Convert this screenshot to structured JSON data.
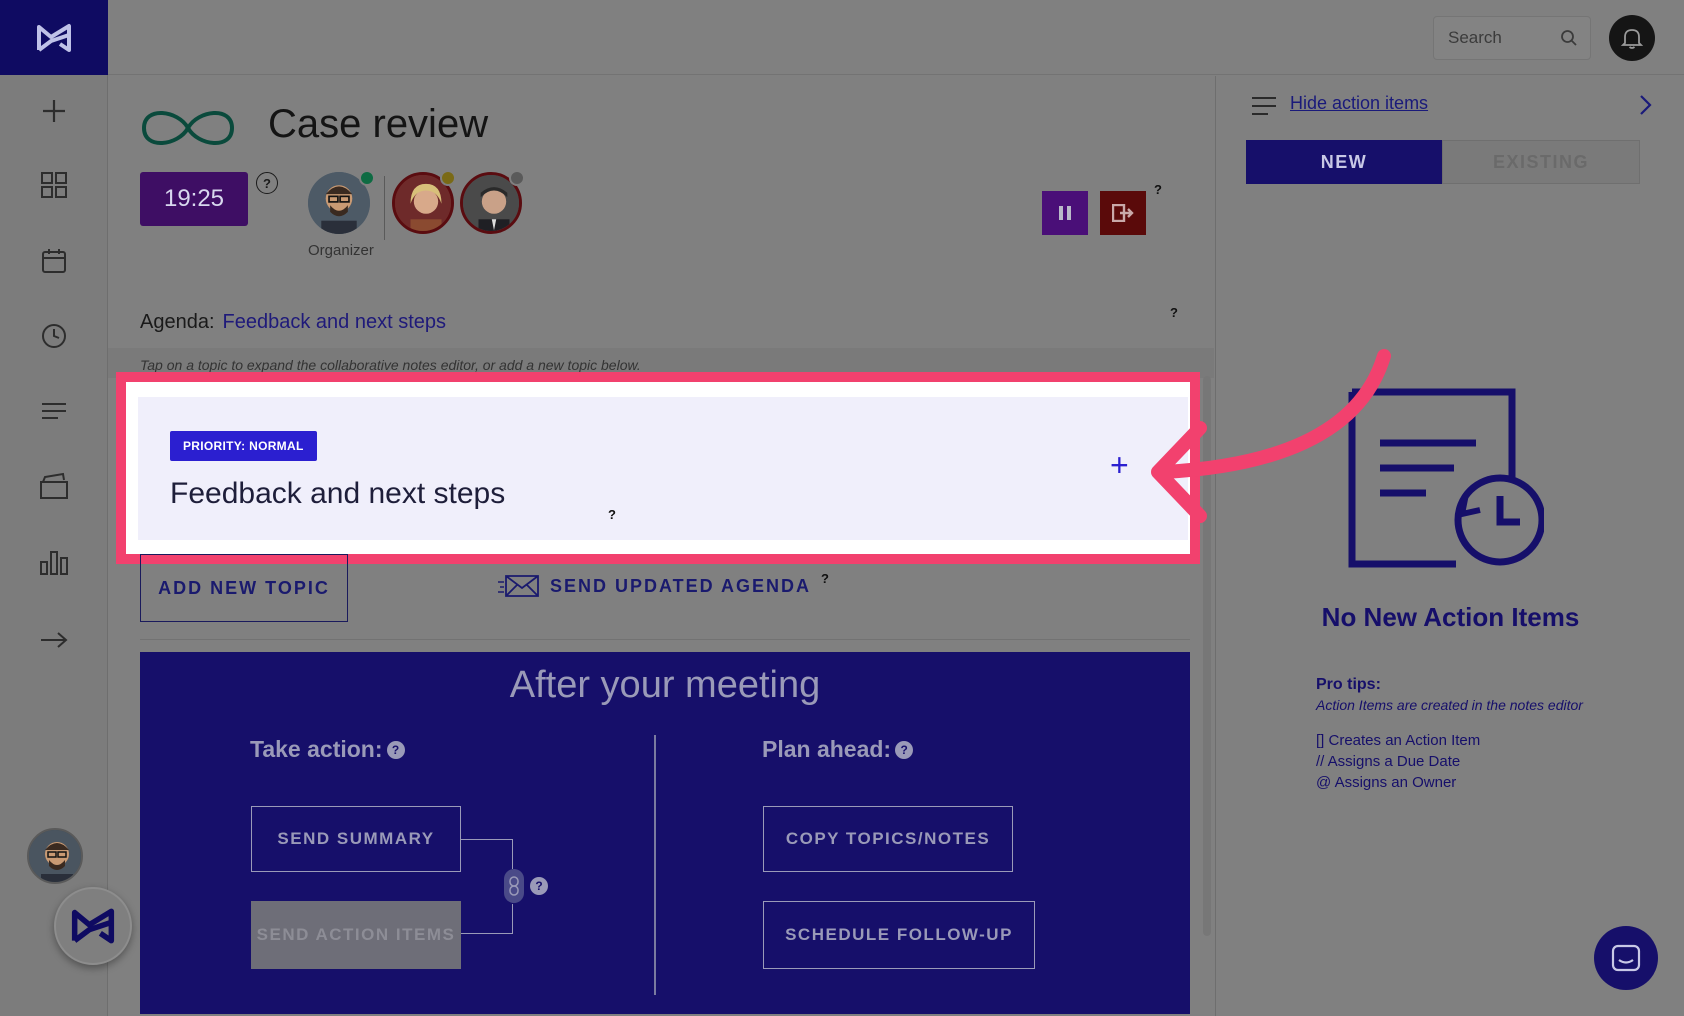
{
  "app": {
    "brand_color": "#0f0b62",
    "accent": "#2b1fd0",
    "highlight": "#f2416e"
  },
  "topbar": {
    "search_placeholder": "Search"
  },
  "meeting": {
    "title": "Case review",
    "timer": "19:25",
    "organizer_label": "Organizer",
    "agenda_label": "Agenda:",
    "agenda_value": "Feedback and next steps",
    "hint": "Tap on a topic to expand the collaborative notes editor, or add a new topic below."
  },
  "topic": {
    "priority": "PRIORITY: NORMAL",
    "title": "Feedback and next steps",
    "plus": "+"
  },
  "actions": {
    "add_topic": "ADD NEW TOPIC",
    "send_agenda": "SEND UPDATED AGENDA"
  },
  "after_meeting": {
    "title": "After your meeting",
    "take_action": "Take action:",
    "plan_ahead": "Plan ahead:",
    "send_summary": "SEND SUMMARY",
    "send_action_items": "SEND ACTION ITEMS",
    "copy_topics": "COPY TOPICS/NOTES",
    "schedule_followup": "SCHEDULE FOLLOW-UP"
  },
  "right_panel": {
    "hide_link": "Hide action items",
    "tab_new": "NEW",
    "tab_existing": "EXISTING",
    "empty_title": "No New Action Items",
    "tips_head": "Pro tips:",
    "tips_sub": "Action Items are created in the notes editor",
    "tip1": "[] Creates an Action Item",
    "tip2": "// Assigns a Due Date",
    "tip3": "@ Assigns an Owner"
  },
  "help_mark": "?"
}
